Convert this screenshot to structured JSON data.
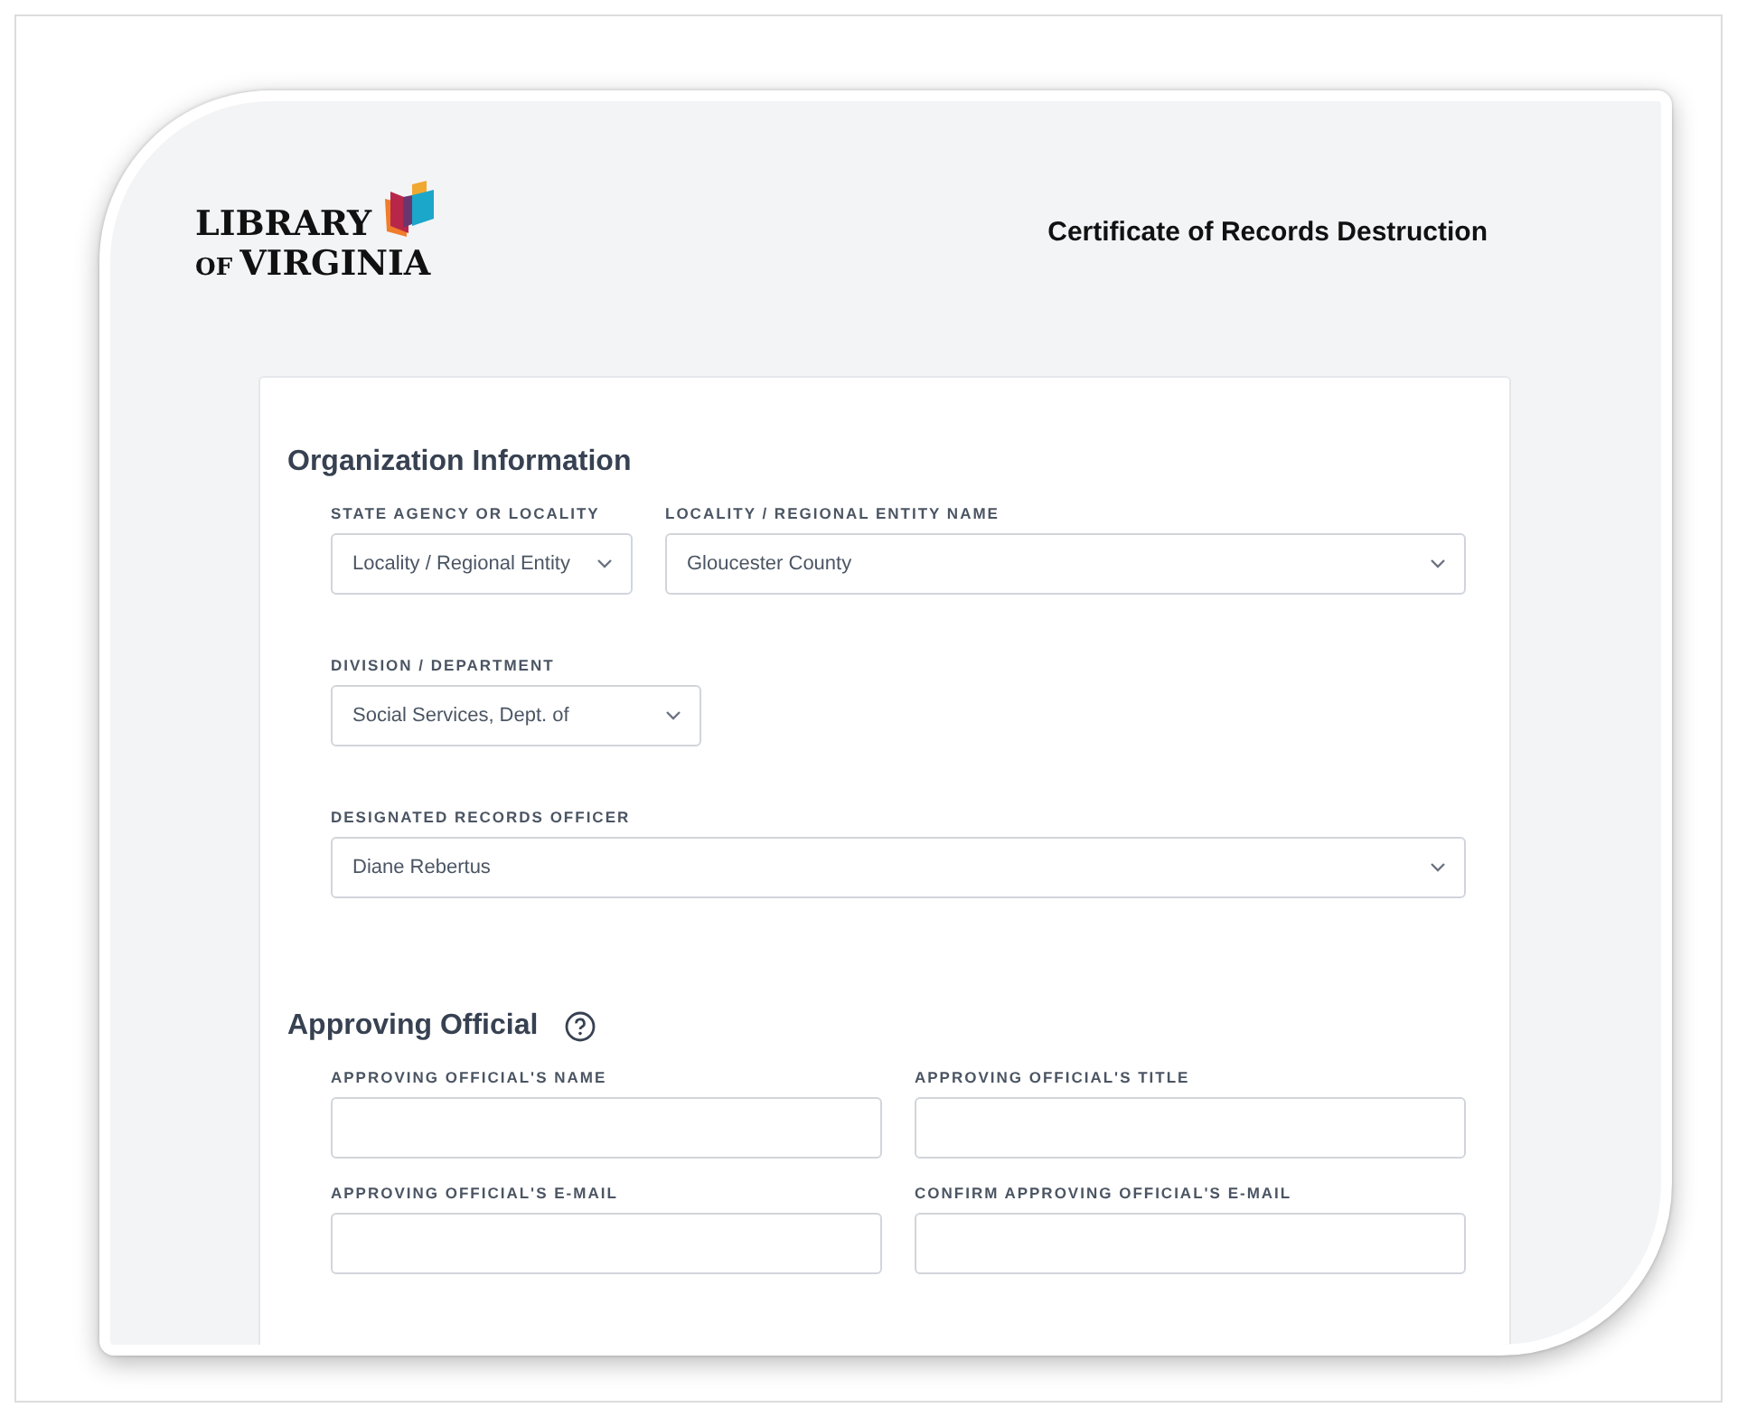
{
  "header": {
    "logo": {
      "line1": "LIBRARY",
      "line2_prefix": "OF",
      "line2": "VIRGINIA"
    },
    "title": "Certificate of Records Destruction"
  },
  "sections": [
    {
      "heading": "Organization Information",
      "help": false,
      "rows": [
        [
          {
            "label": "STATE AGENCY OR LOCALITY",
            "kind": "select",
            "value": "Locality / Regional Entity"
          },
          {
            "label": "LOCALITY / REGIONAL ENTITY NAME",
            "kind": "select",
            "value": "Gloucester County"
          }
        ],
        [
          {
            "label": "DIVISION / DEPARTMENT",
            "kind": "select",
            "value": "Social Services, Dept. of"
          }
        ],
        [
          {
            "label": "DESIGNATED RECORDS OFFICER",
            "kind": "select",
            "value": "Diane Rebertus"
          }
        ]
      ]
    },
    {
      "heading": "Approving Official",
      "help": true,
      "rows": [
        [
          {
            "label": "APPROVING OFFICIAL'S NAME",
            "kind": "text"
          },
          {
            "label": "APPROVING OFFICIAL'S TITLE",
            "kind": "text"
          }
        ],
        [
          {
            "label": "APPROVING OFFICIAL'S E-MAIL",
            "kind": "text"
          },
          {
            "label": "CONFIRM APPROVING OFFICIAL'S E-MAIL",
            "kind": "text"
          }
        ]
      ]
    }
  ]
}
